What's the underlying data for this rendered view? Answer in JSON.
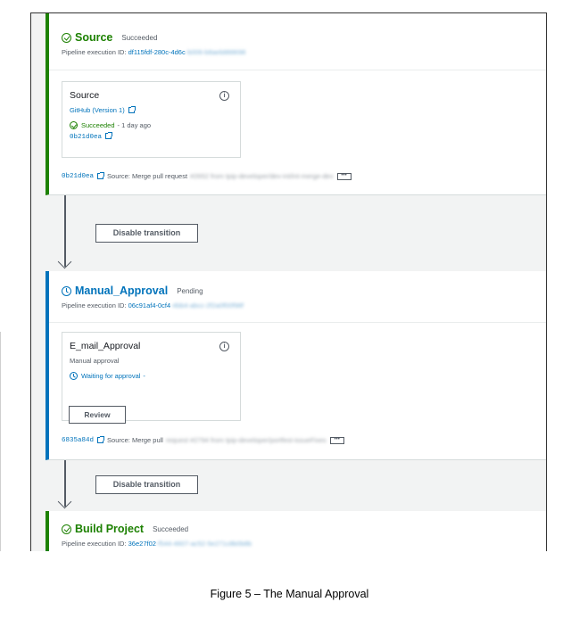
{
  "stages": [
    {
      "title": "Source",
      "status": "Succeeded",
      "exec_label": "Pipeline execution ID:",
      "exec_id": "df115fdf-280c-4d6c",
      "exec_id_rest": "-b006-b8aeb888698",
      "action": {
        "name": "Source",
        "provider": "GitHub (Version 1)",
        "status": "Succeeded",
        "status_time": "- 1 day ago",
        "commit": "0b21d0ea"
      },
      "footer": {
        "commit": "0b21d0ea",
        "text": "Source: Merge pull request",
        "blurred": "#2652 from tpip-developer/dev-int/int-merge-dev"
      }
    },
    {
      "title": "Manual_Approval",
      "status": "Pending",
      "exec_label": "Pipeline execution ID:",
      "exec_id": "06c91af4-0cf4",
      "exec_id_rest": "-4bb4-abcc-2f2a0f00f98f",
      "action": {
        "name": "E_mail_Approval",
        "provider": "Manual approval",
        "status": "Waiting for approval",
        "status_time": "-",
        "button": "Review"
      },
      "footer": {
        "commit": "6835a84d",
        "text": "Source: Merge pull",
        "blurred": "request #2794 from tpip-developer/portfest-issueFixes"
      }
    },
    {
      "title": "Build Project",
      "status": "Succeeded",
      "exec_label": "Pipeline execution ID:",
      "exec_id": "36e27f02",
      "exec_id_rest": "-f544-4607-ac52-5e271c8b0b8b"
    }
  ],
  "transitions": [
    {
      "label": "Disable transition"
    },
    {
      "label": "Disable transition"
    }
  ],
  "caption": "Figure 5 – The Manual Approval",
  "colors": {
    "success": "#1d8102",
    "pending": "#0073bb",
    "link": "#0073bb"
  }
}
